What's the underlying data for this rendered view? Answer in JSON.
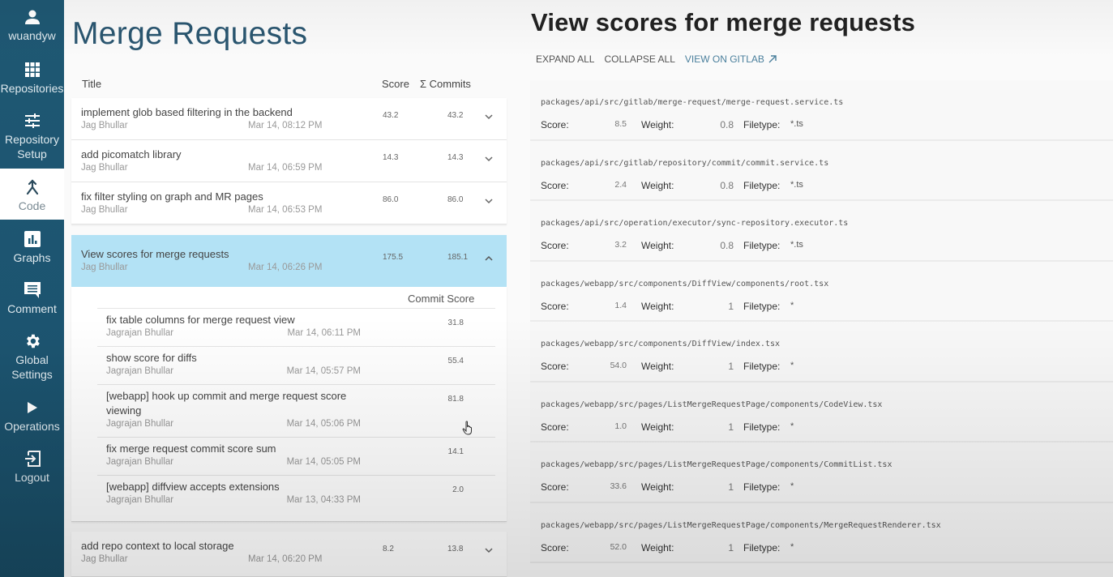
{
  "sidebar": {
    "items": [
      {
        "label": "wuandyw",
        "icon": "user-icon",
        "active": false
      },
      {
        "label": "Repositories",
        "icon": "grid-icon",
        "active": false
      },
      {
        "label": "Repository Setup",
        "icon": "sliders-icon",
        "active": false
      },
      {
        "label": "Code",
        "icon": "merge-icon",
        "active": true
      },
      {
        "label": "Graphs",
        "icon": "bar-chart-icon",
        "active": false
      },
      {
        "label": "Comment",
        "icon": "comment-icon",
        "active": false
      },
      {
        "label": "Global Settings",
        "icon": "gear-icon",
        "active": false
      },
      {
        "label": "Operations",
        "icon": "play-icon",
        "active": false
      },
      {
        "label": "Logout",
        "icon": "logout-icon",
        "active": false
      }
    ]
  },
  "left": {
    "title": "Merge Requests",
    "columns": {
      "title": "Title",
      "score": "Score",
      "commits": "Σ Commits"
    },
    "merge_requests": [
      {
        "title": "implement glob based filtering in the backend",
        "author": "Jag Bhullar",
        "date": "Mar 14, 08:12 PM",
        "score": "43.2",
        "commits": "43.2",
        "expanded": false
      },
      {
        "title": "add picomatch library",
        "author": "Jag Bhullar",
        "date": "Mar 14, 06:59 PM",
        "score": "14.3",
        "commits": "14.3",
        "expanded": false
      },
      {
        "title": "fix filter styling on graph and MR pages",
        "author": "Jag Bhullar",
        "date": "Mar 14, 06:53 PM",
        "score": "86.0",
        "commits": "86.0",
        "expanded": false
      },
      {
        "title": "View scores for merge requests",
        "author": "Jag Bhullar",
        "date": "Mar 14, 06:26 PM",
        "score": "175.5",
        "commits": "185.1",
        "expanded": true
      },
      {
        "title": "add repo context to local storage",
        "author": "Jag Bhullar",
        "date": "Mar 14, 06:20 PM",
        "score": "8.2",
        "commits": "13.8",
        "expanded": false
      }
    ],
    "commit_score_header": "Commit Score",
    "commits": [
      {
        "title": "fix table columns for merge request view",
        "author": "Jagrajan Bhullar",
        "date": "Mar 14, 06:11 PM",
        "score": "31.8"
      },
      {
        "title": "show score for diffs",
        "author": "Jagrajan Bhullar",
        "date": "Mar 14, 05:57 PM",
        "score": "55.4"
      },
      {
        "title": "[webapp] hook up commit and merge request score viewing",
        "author": "Jagrajan Bhullar",
        "date": "Mar 14, 05:06 PM",
        "score": "81.8"
      },
      {
        "title": "fix merge request commit score sum",
        "author": "Jagrajan Bhullar",
        "date": "Mar 14, 05:05 PM",
        "score": "14.1"
      },
      {
        "title": "[webapp] diffview accepts extensions",
        "author": "Jagrajan Bhullar",
        "date": "Mar 13, 04:33 PM",
        "score": "2.0"
      }
    ]
  },
  "right": {
    "title": "View scores for merge requests",
    "actions": {
      "expand_all": "EXPAND ALL",
      "collapse_all": "COLLAPSE ALL",
      "view_on_gitlab": "VIEW ON GITLAB"
    },
    "labels": {
      "score": "Score:",
      "weight": "Weight:",
      "filetype": "Filetype:"
    },
    "files": [
      {
        "path": "packages/api/src/gitlab/merge-request/merge-request.service.ts",
        "score": "8.5",
        "weight": "0.8",
        "filetype": "*.ts"
      },
      {
        "path": "packages/api/src/gitlab/repository/commit/commit.service.ts",
        "score": "2.4",
        "weight": "0.8",
        "filetype": "*.ts"
      },
      {
        "path": "packages/api/src/operation/executor/sync-repository.executor.ts",
        "score": "3.2",
        "weight": "0.8",
        "filetype": "*.ts"
      },
      {
        "path": "packages/webapp/src/components/DiffView/components/root.tsx",
        "score": "1.4",
        "weight": "1",
        "filetype": "*"
      },
      {
        "path": "packages/webapp/src/components/DiffView/index.tsx",
        "score": "54.0",
        "weight": "1",
        "filetype": "*"
      },
      {
        "path": "packages/webapp/src/pages/ListMergeRequestPage/components/CodeView.tsx",
        "score": "1.0",
        "weight": "1",
        "filetype": "*"
      },
      {
        "path": "packages/webapp/src/pages/ListMergeRequestPage/components/CommitList.tsx",
        "score": "33.6",
        "weight": "1",
        "filetype": "*"
      },
      {
        "path": "packages/webapp/src/pages/ListMergeRequestPage/components/MergeRequestRenderer.tsx",
        "score": "52.0",
        "weight": "1",
        "filetype": "*"
      }
    ]
  },
  "colors": {
    "sidebar_bg": "#1f5873",
    "selected_row": "#b3e2f5",
    "title_accent": "#2a5670",
    "link": "#4a7f9c"
  }
}
